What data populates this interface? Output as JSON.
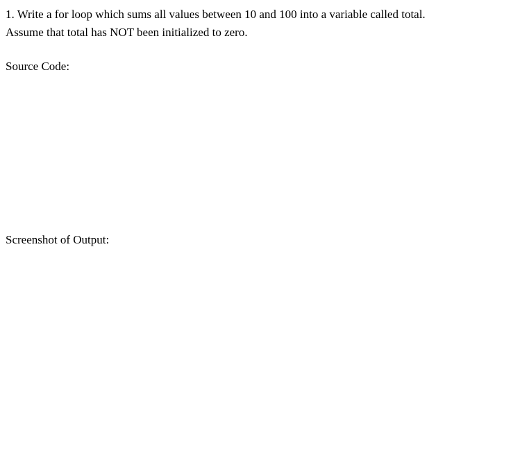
{
  "question": {
    "number": "1.",
    "text_line1": "1. Write a for loop which sums all values between 10 and 100 into a variable called total.",
    "text_line2": "Assume that total has NOT been initialized to zero."
  },
  "sections": {
    "source_code_label": "Source Code:",
    "output_label": "Screenshot of Output:"
  }
}
